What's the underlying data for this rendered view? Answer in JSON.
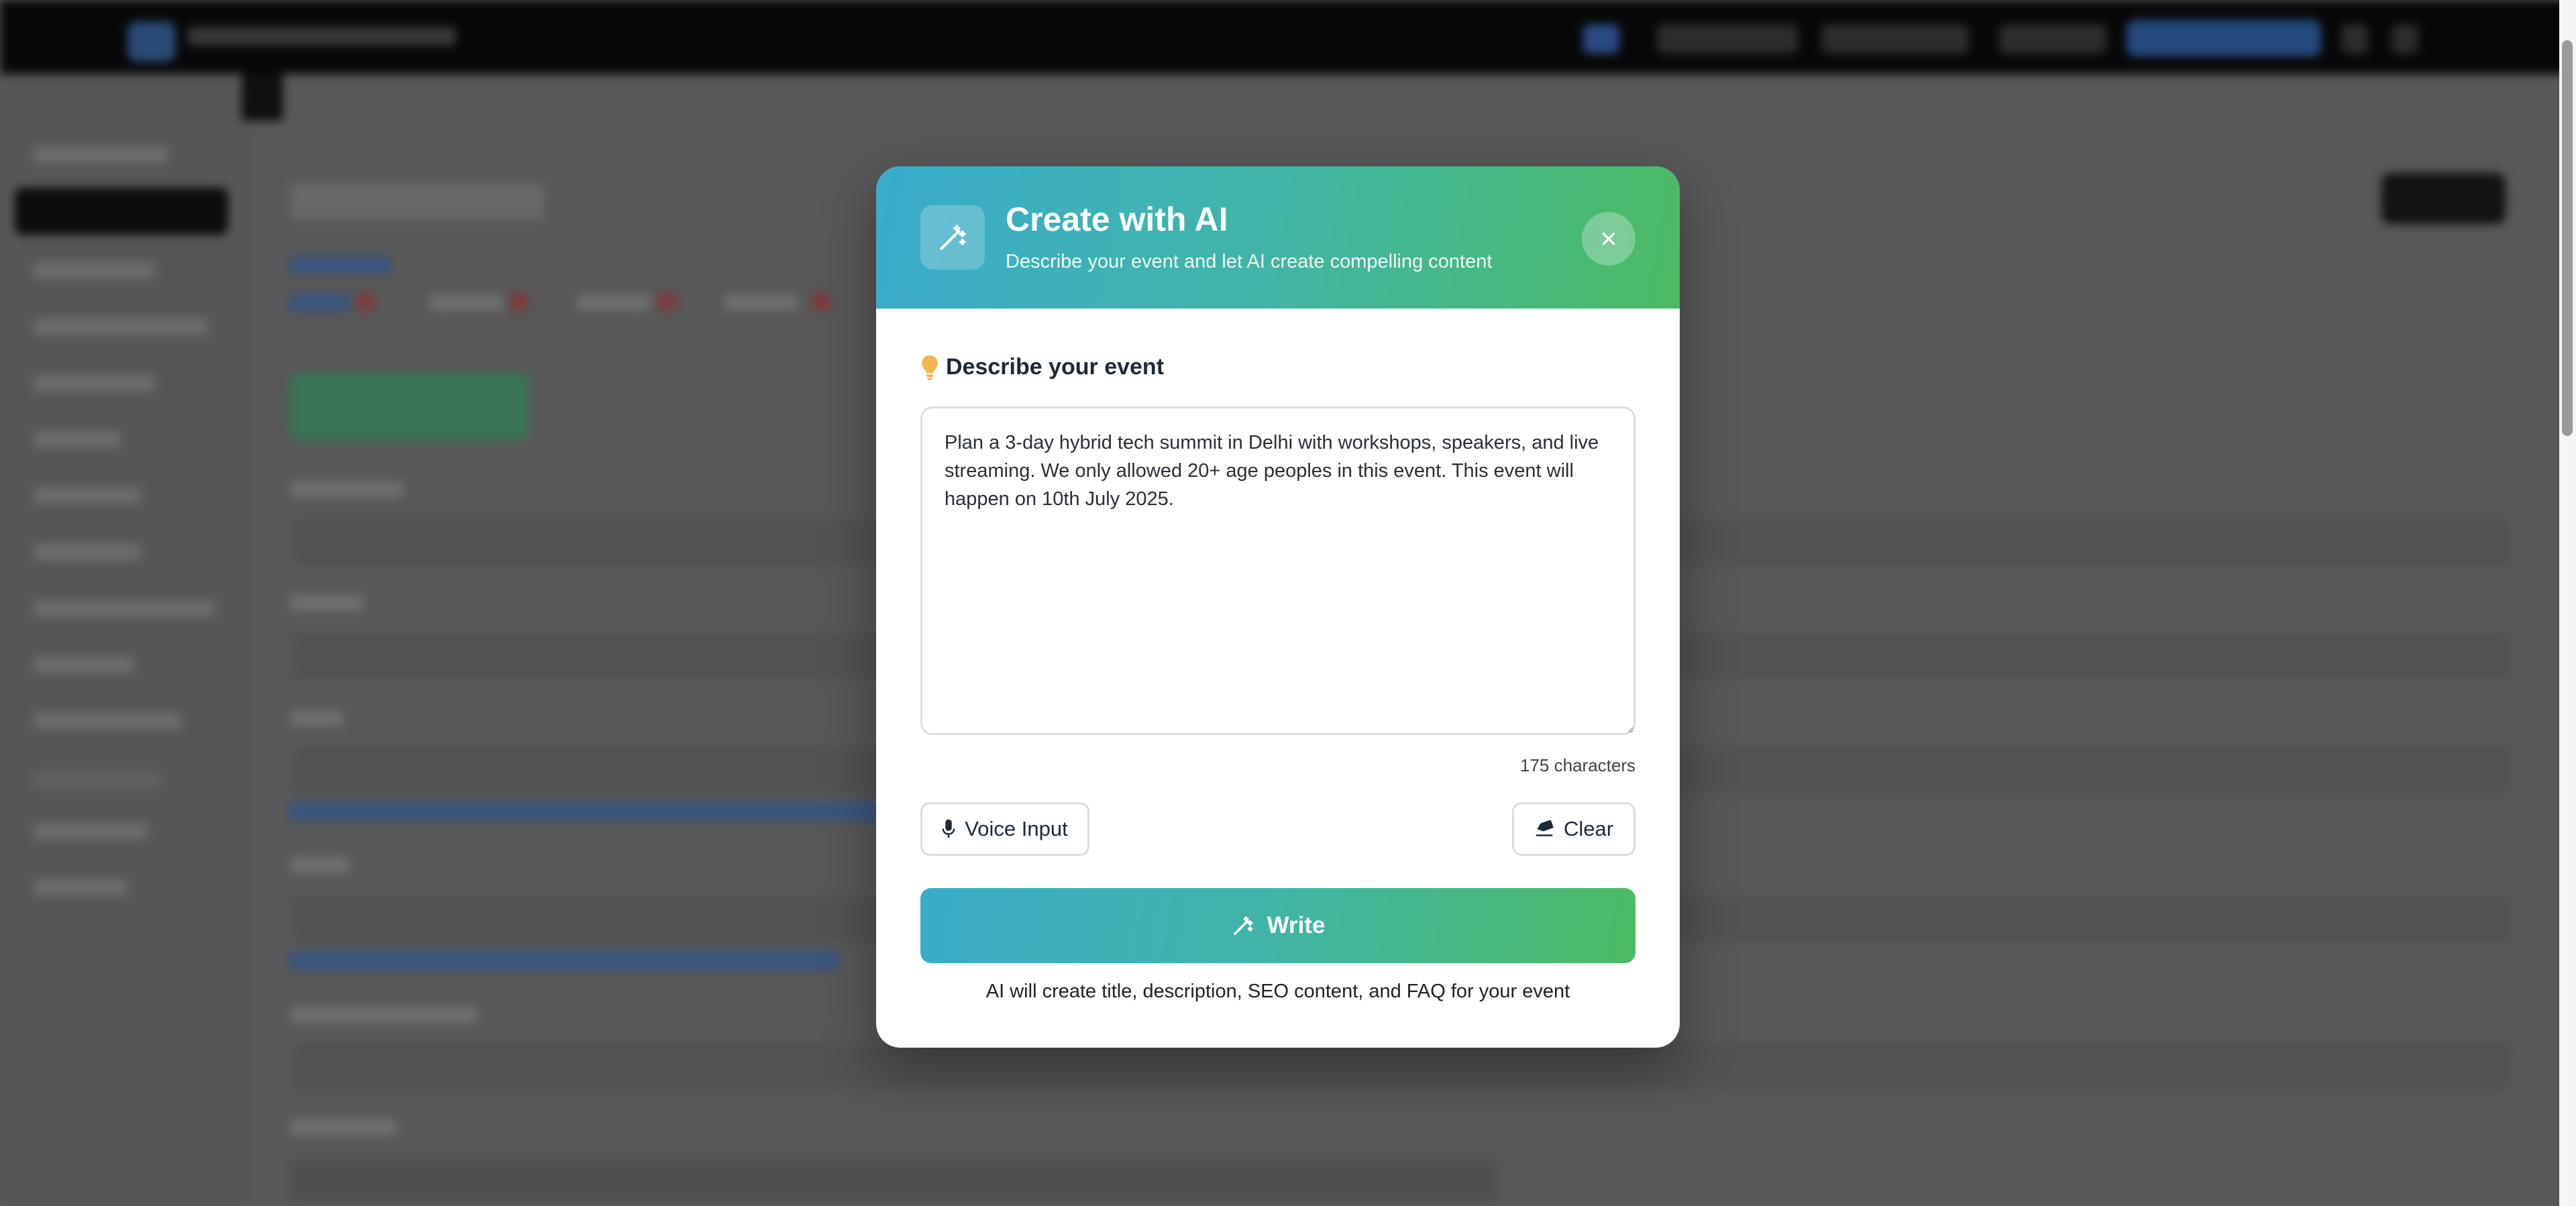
{
  "modal": {
    "title": "Create with AI",
    "subtitle": "Describe your event and let AI create compelling content",
    "close_icon": "close-icon",
    "header_icon": "magic-wand-icon",
    "section_label": "Describe your event",
    "section_icon": "lightbulb-icon",
    "description_value": "Plan a 3-day hybrid tech summit in Delhi with workshops, speakers, and live streaming. We only allowed 20+ age peoples in this event. This event will happen on 10th July 2025.",
    "char_count": "175 characters",
    "voice_label": "Voice Input",
    "voice_icon": "microphone-icon",
    "clear_label": "Clear",
    "clear_icon": "eraser-icon",
    "write_label": "Write",
    "write_icon": "magic-wand-icon",
    "footnote": "AI will create title, description, SEO content, and FAQ for your event"
  },
  "colors": {
    "gradient_start": "#3aaccd",
    "gradient_end": "#4cbb63",
    "bulb": "#f5b452"
  }
}
